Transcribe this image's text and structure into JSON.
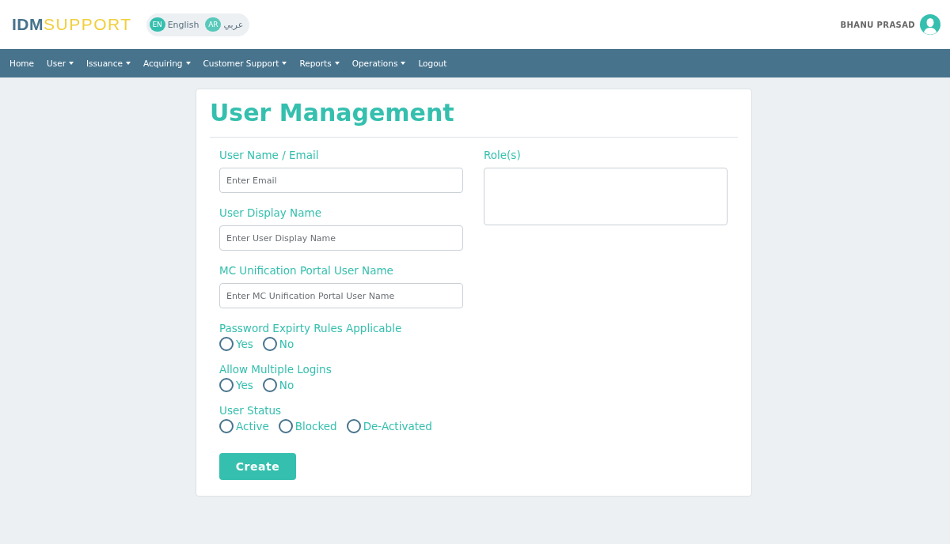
{
  "header": {
    "logo": {
      "primary": "IDM",
      "secondary": "SUPPORT"
    },
    "languages": [
      {
        "code": "EN",
        "label": "English",
        "selected": true
      },
      {
        "code": "AR",
        "label": "عربي",
        "selected": false
      }
    ],
    "user": {
      "name": "BHANU PRASAD"
    }
  },
  "nav": [
    {
      "label": "Home",
      "dropdown": false
    },
    {
      "label": "User",
      "dropdown": true
    },
    {
      "label": "Issuance",
      "dropdown": true
    },
    {
      "label": "Acquiring",
      "dropdown": true
    },
    {
      "label": "Customer Support",
      "dropdown": true
    },
    {
      "label": "Reports",
      "dropdown": true
    },
    {
      "label": "Operations",
      "dropdown": true
    },
    {
      "label": "Logout",
      "dropdown": false
    }
  ],
  "form": {
    "title": "User Management",
    "fields": [
      {
        "label": "User Name / Email",
        "placeholder": "Enter Email"
      },
      {
        "label": "User Display Name",
        "placeholder": "Enter User Display Name"
      },
      {
        "label": "MC Unification Portal User Name",
        "placeholder": "Enter MC Unification Portal User Name"
      }
    ],
    "radio_groups": [
      {
        "label": "Password Expirty Rules Applicable",
        "options": [
          {
            "label": "Yes",
            "selected": false
          },
          {
            "label": "No",
            "selected": false
          }
        ]
      },
      {
        "label": "Allow Multiple Logins",
        "options": [
          {
            "label": "Yes",
            "selected": false
          },
          {
            "label": "No",
            "selected": false
          }
        ]
      },
      {
        "label": "User Status",
        "options": [
          {
            "label": "Active",
            "selected": false
          },
          {
            "label": "Blocked",
            "selected": false
          },
          {
            "label": "De-Activated",
            "selected": false
          }
        ]
      }
    ],
    "roles": {
      "label": "Role(s)"
    },
    "submit": "Create"
  }
}
